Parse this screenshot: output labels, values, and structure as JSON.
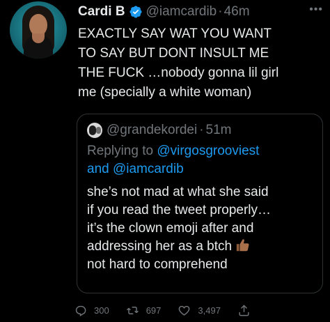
{
  "tweet": {
    "author_name": "Cardi B",
    "author_handle": "@iamcardib",
    "separator": "·",
    "time": "46m",
    "more_icon": "more-horizontal-icon",
    "text": "EXACTLY SAY WAT YOU WANT\nTO SAY BUT DONT INSULT ME\nTHE FUCK …nobody gonna lil girl\nme (specially a white woman)"
  },
  "quote": {
    "handle": "@grandekordei",
    "separator": "·",
    "time": "51m",
    "replying_prefix": "Replying to",
    "reply_mention_1": "@virgosgrooviest",
    "reply_and": "and",
    "reply_mention_2": "@iamcardib",
    "text_before_emoji": "she’s not mad at what she said\nif you read the tweet properly…\nit’s the clown emoji after and\naddressing her as a btch ",
    "text_after_emoji": "\nnot hard to comprehend",
    "emoji_icon": "thumbs-up-icon"
  },
  "actions": {
    "replies": "300",
    "retweets": "697",
    "likes": "3,497"
  },
  "colors": {
    "background": "#000000",
    "text": "#e7e9ea",
    "secondary": "#71767b",
    "link": "#1d9bf0",
    "verified": "#1d9bf0",
    "border": "#2f3336"
  }
}
